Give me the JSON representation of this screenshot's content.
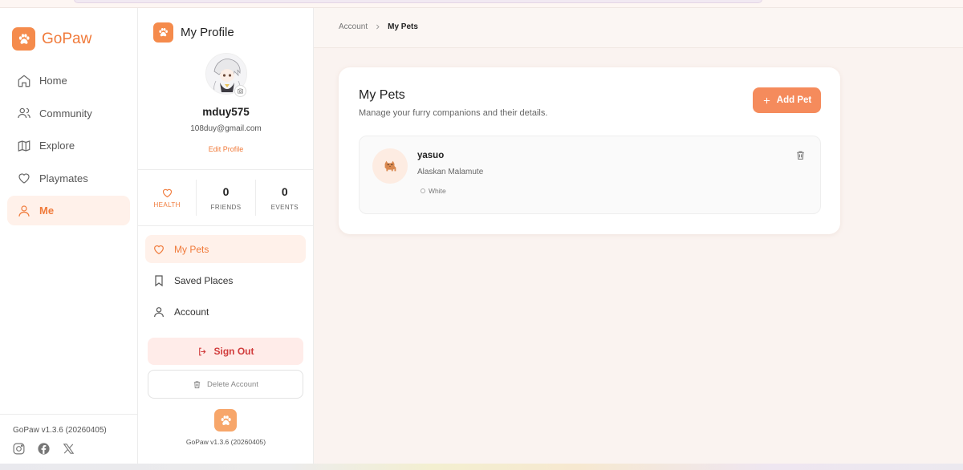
{
  "app": {
    "brand": "GoPaw",
    "accent": "#f07a3a",
    "version": "GoPaw v1.3.6 (20260405)"
  },
  "sidebar": {
    "items": [
      {
        "label": "Home",
        "icon": "home-icon"
      },
      {
        "label": "Community",
        "icon": "users-icon"
      },
      {
        "label": "Explore",
        "icon": "map-icon"
      },
      {
        "label": "Playmates",
        "icon": "heart-icon"
      },
      {
        "label": "Me",
        "icon": "user-icon",
        "active": true
      }
    ],
    "socials": [
      "instagram-icon",
      "facebook-icon",
      "x-icon"
    ]
  },
  "profile": {
    "title": "My Profile",
    "username": "mduy575",
    "email": "108duy@gmail.com",
    "edit_label": "Edit Profile",
    "stats": {
      "health_label": "HEALTH",
      "friends_value": "0",
      "friends_label": "FRIENDS",
      "events_value": "0",
      "events_label": "EVENTS"
    },
    "menu": [
      {
        "label": "My Pets",
        "icon": "heart-icon",
        "active": true
      },
      {
        "label": "Saved Places",
        "icon": "bookmark-icon"
      },
      {
        "label": "Account",
        "icon": "user-icon"
      }
    ],
    "signout_label": "Sign Out",
    "delete_label": "Delete Account",
    "signout_color": "#d13c3c"
  },
  "main": {
    "breadcrumb": [
      "Account",
      "My Pets"
    ],
    "title": "My Pets",
    "subtitle": "Manage your furry companions and their details.",
    "add_label": "Add Pet",
    "add_color": "#f58b5c",
    "pets": [
      {
        "name": "yasuo",
        "breed": "Alaskan Malamute",
        "color": "White"
      }
    ]
  }
}
